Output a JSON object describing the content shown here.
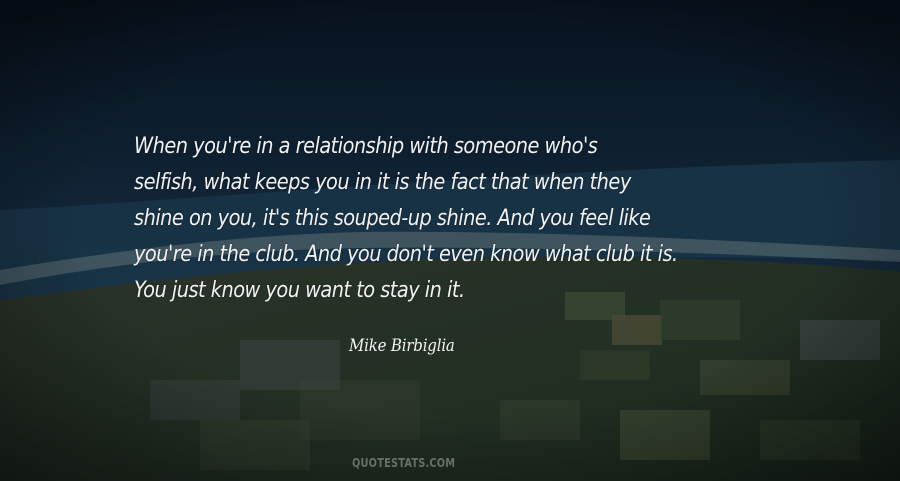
{
  "quote": {
    "lines": [
      "When you're in a relationship with someone who's",
      "selfish, what keeps you in it is the fact that when they",
      "shine on you, it's this souped-up shine. And you feel like",
      "you're in the club. And you don't even know what club it is.",
      "You just know you want to stay in it."
    ]
  },
  "author": "Mike Birbiglia",
  "watermark": "QUOTESTATS.COM",
  "colors": {
    "sky_top": "#0a1624",
    "sea": "#132a3a",
    "land": "#1e2a1f",
    "text": "#f2f2f2"
  }
}
